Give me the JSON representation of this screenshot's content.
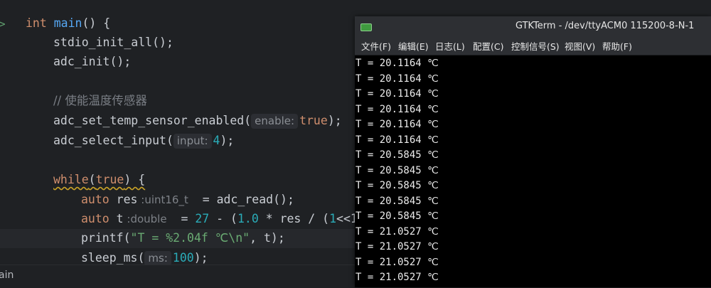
{
  "editor": {
    "line1": {
      "kw": "int",
      "fn": "main",
      "rest": "() {"
    },
    "line2": {
      "fn": "stdio_init_all",
      "rest": "();"
    },
    "line3": {
      "fn": "adc_init",
      "rest": "();"
    },
    "line5": {
      "comment": "// 使能温度传感器"
    },
    "line6": {
      "fn": "adc_set_temp_sensor_enabled",
      "open": "(",
      "hint": "enable:",
      "arg": "true",
      "close": ");"
    },
    "line7": {
      "fn": "adc_select_input",
      "open": "(",
      "hint": "input:",
      "arg": "4",
      "close": ");"
    },
    "line9": {
      "kw": "while",
      "open": "(",
      "kw2": "true",
      "close": ") {"
    },
    "line10": {
      "kw": "auto",
      "name": " res",
      "hint": "uint16_t",
      "eq": "  = ",
      "fn": "adc_read",
      "rest": "();"
    },
    "line11": {
      "kw": "auto",
      "name": " t",
      "hint": "double",
      "eq": "  = ",
      "n1": "27",
      "m1": " - (",
      "n2": "1.0",
      "m2": " * res / (",
      "n3": "1",
      "m3": "<<1"
    },
    "line12": {
      "fn": "printf",
      "open": "(",
      "str": "\"T = %2.04f ℃\\n\"",
      "rest": ", t);"
    },
    "line13": {
      "fn": "sleep_ms",
      "open": "(",
      "hint": "ms:",
      "arg": "100",
      "close": ");"
    },
    "status_text": "ain"
  },
  "terminal": {
    "title": "GTKTerm - /dev/ttyACM0 115200-8-N-1",
    "menu": [
      "文件(F)",
      "编辑(E)",
      "日志(L)",
      "配置(C)",
      "控制信号(S)",
      "视图(V)",
      "帮助(F)"
    ],
    "lines": [
      "T = 20.1164 ℃",
      "T = 20.1164 ℃",
      "T = 20.1164 ℃",
      "T = 20.1164 ℃",
      "T = 20.1164 ℃",
      "T = 20.1164 ℃",
      "T = 20.5845 ℃",
      "T = 20.5845 ℃",
      "T = 20.5845 ℃",
      "T = 20.5845 ℃",
      "T = 20.5845 ℃",
      "T = 21.0527 ℃",
      "T = 21.0527 ℃",
      "T = 21.0527 ℃",
      "T = 21.0527 ℃"
    ]
  }
}
